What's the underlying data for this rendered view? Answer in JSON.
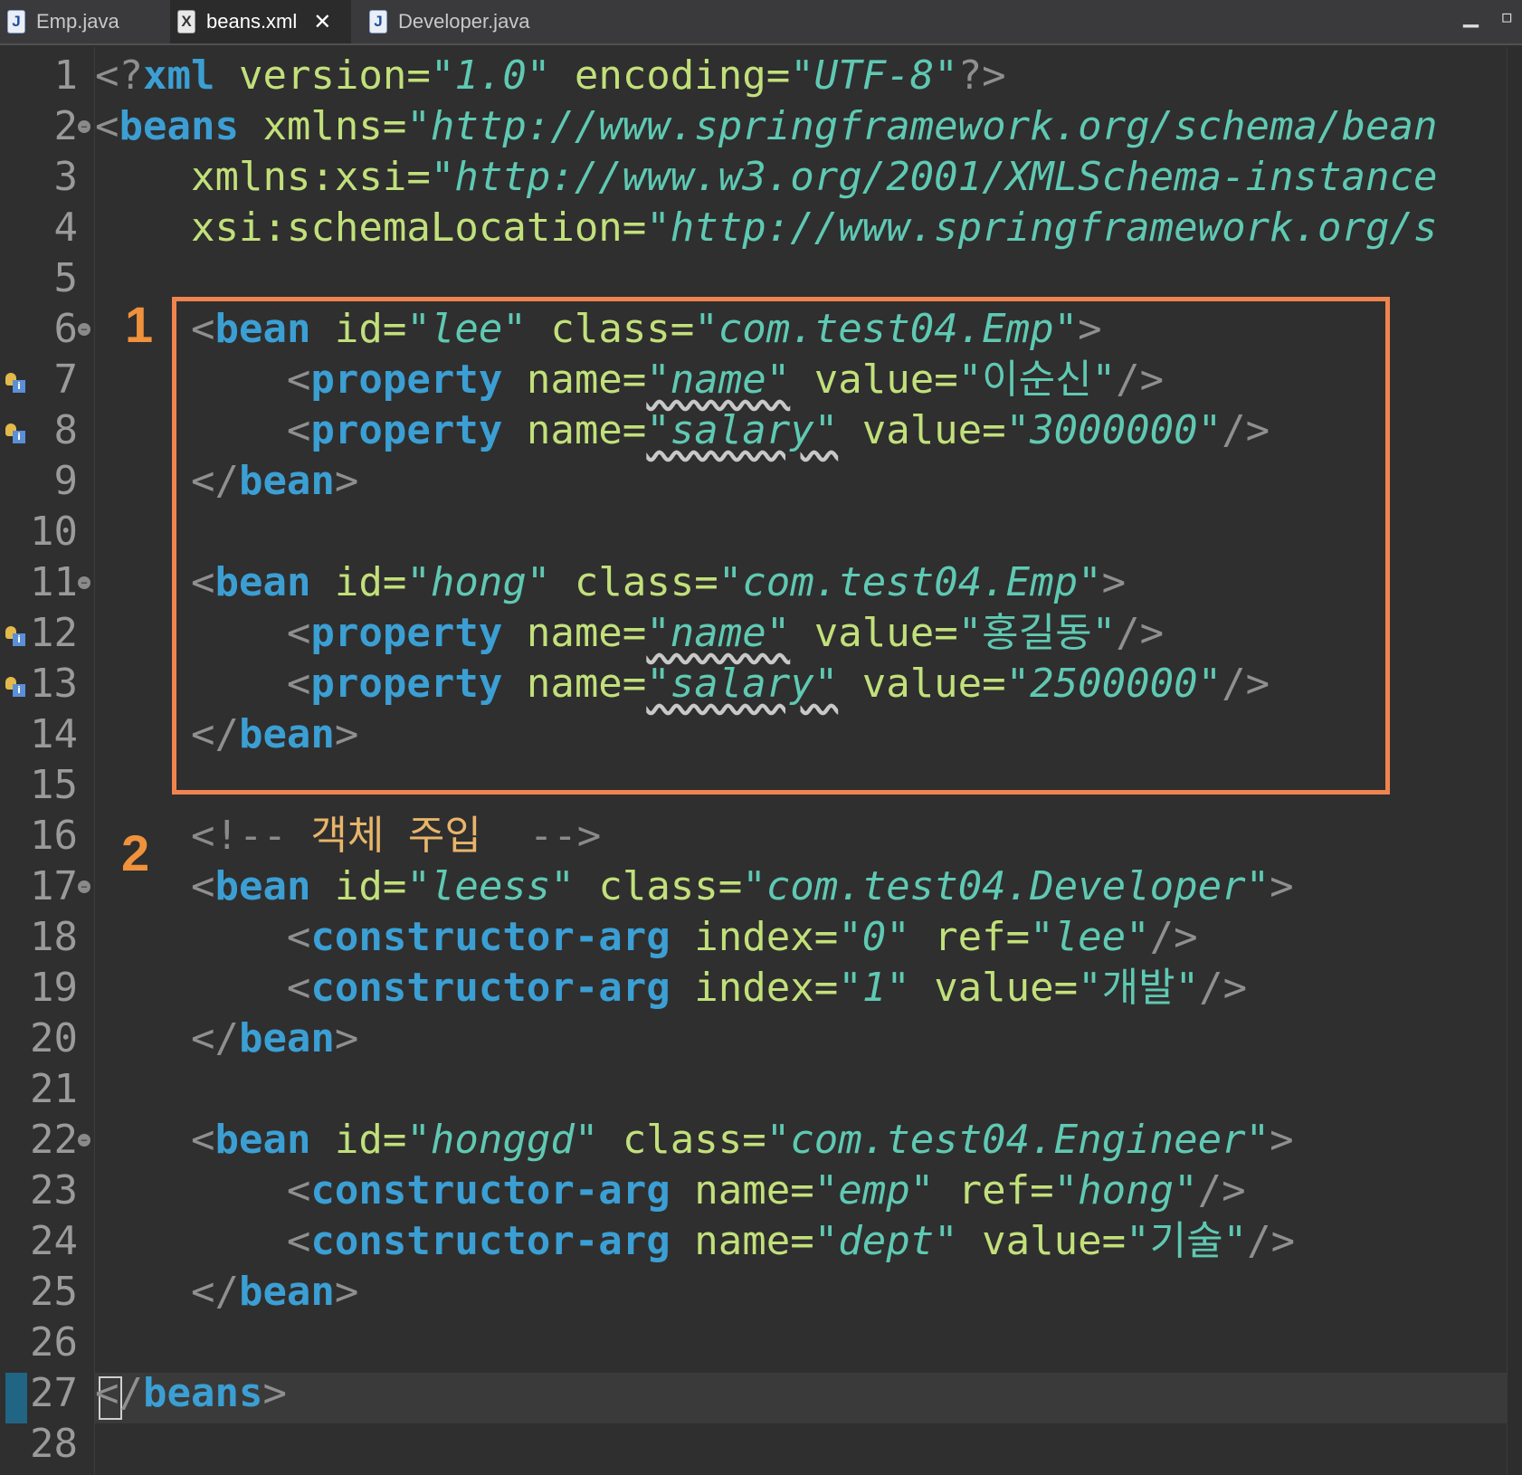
{
  "tabs": [
    {
      "label": "Emp.java",
      "icon": "J",
      "active": false
    },
    {
      "label": "beans.xml",
      "icon": "X",
      "active": true
    },
    {
      "label": "Developer.java",
      "icon": "J",
      "active": false
    }
  ],
  "window_controls": {
    "minimize": "▁",
    "maximize": "▫"
  },
  "markers": {
    "first": "1",
    "second": "2"
  },
  "line_numbers": [
    "1",
    "2",
    "3",
    "4",
    "5",
    "6",
    "7",
    "8",
    "9",
    "10",
    "11",
    "12",
    "13",
    "14",
    "15",
    "16",
    "17",
    "18",
    "19",
    "20",
    "21",
    "22",
    "23",
    "24",
    "25",
    "26",
    "27",
    "28"
  ],
  "code": {
    "l1": {
      "open": "<?",
      "tag": "xml",
      "a1": " version=",
      "v1": "\"1.0\"",
      "a2": " encoding=",
      "v2": "\"UTF-8\"",
      "close": "?>"
    },
    "l2": {
      "open": "<",
      "tag": "beans",
      "a1": " xmlns=",
      "v1": "\"http://www.springframework.org/schema/bean"
    },
    "l3": {
      "indent": "    ",
      "a1": "xmlns:xsi=",
      "v1": "\"http://www.w3.org/2001/XMLSchema-instance"
    },
    "l4": {
      "indent": "    ",
      "a1": "xsi:schemaLocation=",
      "v1": "\"http://www.springframework.org/s"
    },
    "l6": {
      "indent": "    ",
      "open": "<",
      "tag": "bean",
      "a1": " id=",
      "v1": "\"lee\"",
      "a2": " class=",
      "v2": "\"com.test04.Emp\"",
      "close": ">"
    },
    "l7": {
      "indent": "        ",
      "open": "<",
      "tag": "property",
      "a1": " name=",
      "v1": "\"name\"",
      "a2": " value=",
      "v2": "\"이순신\"",
      "close": "/>"
    },
    "l8": {
      "indent": "        ",
      "open": "<",
      "tag": "property",
      "a1": " name=",
      "v1": "\"salary\"",
      "a2": " value=",
      "v2": "\"3000000\"",
      "close": "/>"
    },
    "l9": {
      "indent": "    ",
      "open": "</",
      "tag": "bean",
      "close": ">"
    },
    "l11": {
      "indent": "    ",
      "open": "<",
      "tag": "bean",
      "a1": " id=",
      "v1": "\"hong\"",
      "a2": " class=",
      "v2": "\"com.test04.Emp\"",
      "close": ">"
    },
    "l12": {
      "indent": "        ",
      "open": "<",
      "tag": "property",
      "a1": " name=",
      "v1": "\"name\"",
      "a2": " value=",
      "v2": "\"홍길동\"",
      "close": "/>"
    },
    "l13": {
      "indent": "        ",
      "open": "<",
      "tag": "property",
      "a1": " name=",
      "v1": "\"salary\"",
      "a2": " value=",
      "v2": "\"2500000\"",
      "close": "/>"
    },
    "l14": {
      "indent": "    ",
      "open": "</",
      "tag": "bean",
      "close": ">"
    },
    "l16": {
      "indent": "    ",
      "open": "<!--",
      "text": " 객체 주입 ",
      "close": " -->"
    },
    "l17": {
      "indent": "    ",
      "open": "<",
      "tag": "bean",
      "a1": " id=",
      "v1": "\"leess\"",
      "a2": " class=",
      "v2": "\"com.test04.Developer\"",
      "close": ">"
    },
    "l18": {
      "indent": "        ",
      "open": "<",
      "tag": "constructor-arg",
      "a1": " index=",
      "v1": "\"0\"",
      "a2": " ref=",
      "v2": "\"lee\"",
      "close": "/>"
    },
    "l19": {
      "indent": "        ",
      "open": "<",
      "tag": "constructor-arg",
      "a1": " index=",
      "v1": "\"1\"",
      "a2": " value=",
      "v2": "\"개발\"",
      "close": "/>"
    },
    "l20": {
      "indent": "    ",
      "open": "</",
      "tag": "bean",
      "close": ">"
    },
    "l22": {
      "indent": "    ",
      "open": "<",
      "tag": "bean",
      "a1": " id=",
      "v1": "\"honggd\"",
      "a2": " class=",
      "v2": "\"com.test04.Engineer\"",
      "close": ">"
    },
    "l23": {
      "indent": "        ",
      "open": "<",
      "tag": "constructor-arg",
      "a1": " name=",
      "v1": "\"emp\"",
      "a2": " ref=",
      "v2": "\"hong\"",
      "close": "/>"
    },
    "l24": {
      "indent": "        ",
      "open": "<",
      "tag": "constructor-arg",
      "a1": " name=",
      "v1": "\"dept\"",
      "a2": " value=",
      "v2": "\"기술\"",
      "close": "/>"
    },
    "l25": {
      "indent": "    ",
      "open": "</",
      "tag": "bean",
      "close": ">"
    },
    "l27": {
      "open": "</",
      "tag": "beans",
      "close": ">"
    }
  },
  "colors": {
    "tag": "#3b9fd4",
    "attribute": "#c2e07a",
    "value": "#5fc9b3",
    "comment": "#8a8a8a",
    "comment_text": "#e8b56a",
    "highlight_box": "#f0844f",
    "marker": "#f0913c"
  }
}
